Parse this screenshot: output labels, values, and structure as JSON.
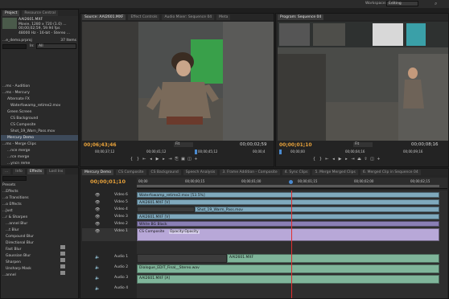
{
  "app": {
    "workspace_label": "Workspace:",
    "workspace_value": "Editing"
  },
  "project": {
    "tabs": [
      "Project",
      "Resource Central"
    ],
    "clip_name": "AAI2601.MXF",
    "clip_info_1": "Movie, 1280 x 720 (1.0) ...",
    "clip_info_2": "00;00;02;59, 59.94 fps",
    "clip_info_3": "48000 Hz - 16-bit - Stereo ...",
    "project_file": "...e_demo.prproj",
    "item_count": "37 Items",
    "in_label": "In:",
    "in_value": "All",
    "items": [
      "...ms - Audition",
      "...ms - Mercury",
      "Alternate FX",
      "Waterfowamp_retime2.mov",
      "Green Screen",
      "CS Background",
      "CS Composite",
      "Shot_19_Warn_Pass.mov",
      "Mercury Demo",
      "...ms - Merge Clips",
      "...nce merge",
      "...rce merge",
      "...yncn reme"
    ]
  },
  "effects": {
    "tabs": [
      "...",
      "Info",
      "Effects",
      "Lost Ins"
    ],
    "items": [
      "Presets",
      "...Effects",
      "...o Transitions",
      "...o Effects",
      "...Just",
      "...r & Sharpen",
      "...annel Blur",
      "...t Blur",
      "Compound Blur",
      "Directional Blur",
      "Fast Blur",
      "Gaussian Blur",
      "Sharpen",
      "Unsharp Mask",
      "...annel"
    ]
  },
  "source": {
    "tabs": [
      "Source: AAI2601.MXF",
      "Effect Controls",
      "Audio Mixer: Sequence 04",
      "Meta"
    ],
    "timecode_in": "00;06;43;46",
    "fit": "Fit",
    "duration": "00;00;02;59",
    "ruler": [
      "00;00;37;12",
      "00;00;41;12",
      "00;00;45;12",
      "00;00;4"
    ]
  },
  "program": {
    "tabs": [
      "Program: Sequence 04"
    ],
    "timecode_in": "00;00;01;10",
    "fit": "Fit",
    "duration": "00;00;08;16",
    "ruler": [
      "00;00;00",
      "00;00;04;16",
      "00;00;09;16"
    ]
  },
  "timeline": {
    "tabs": [
      "Mercury Demo",
      "CS Composite",
      "CS Background",
      "Speech Analysis",
      "3. Frame Addition - Composite",
      "4. Sync Clips",
      "5. Merge Merged Clips",
      "6. Merged Clip in Sequence 04"
    ],
    "timecode": "00;00;01;10",
    "ruler": [
      "00;00",
      "00;00;00;15",
      "00;00;01;00",
      "00;00;01;15",
      "00;00;02;00",
      "00;00;02;15"
    ],
    "video_tracks": [
      "Video 6",
      "Video 5",
      "Video 4",
      "Video 3",
      "Video 2",
      "Video 1"
    ],
    "audio_tracks": [
      "Audio 1",
      "Audio 2",
      "Audio 3",
      "Audio 4"
    ],
    "clips": {
      "v6": "Waterfowamp_retime2.mov [53.5%]",
      "v5": "AAI2601.MXF [V]",
      "v4": "Shot_19_Warm_Pass.mov",
      "v3": "AAI2601.MXF [V]",
      "v2": "White BG Black",
      "v1": "CS Composite",
      "v1_fx": "Opacity:Opacity",
      "a1": "AAI2601.MXF",
      "a2": "Dialogue_EDIT_Final__Stereo.wav",
      "a3": "AAI2601.MXF [A]"
    }
  },
  "colors": {
    "accent_timecode": "#e8a23a",
    "playhead": "#e03030",
    "video_clip": "#7fa9bd",
    "video_clip_alt": "#8a7fb5",
    "audio_clip": "#7fb59a"
  }
}
